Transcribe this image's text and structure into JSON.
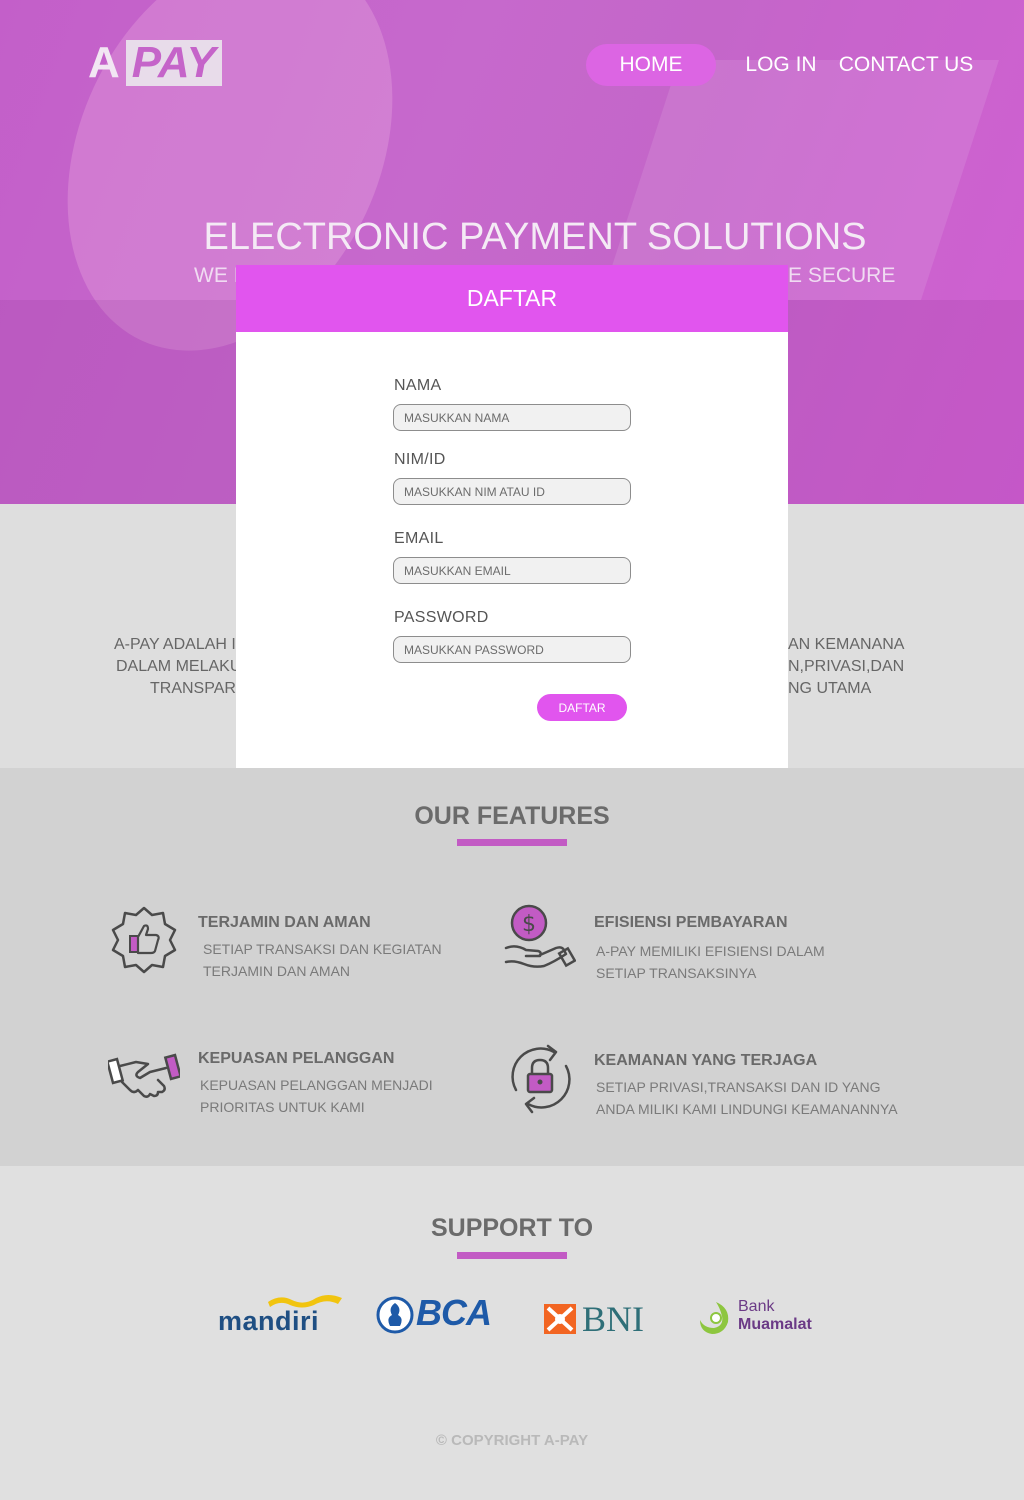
{
  "brand": {
    "logo_a": "A",
    "logo_pay": "PAY",
    "accent": "#c25bc4",
    "modal_accent": "#e155ee"
  },
  "nav": {
    "home": "HOME",
    "login": "LOG IN",
    "contact": "CONTACT US"
  },
  "hero": {
    "title": "ELECTRONIC PAYMENT SOLUTIONS",
    "subtitle_left": "WE I",
    "subtitle_right": "E SECURE"
  },
  "about": {
    "line1_left": "A-PAY ADALAH I",
    "line1_right": "AN KEMANANA",
    "line2_left": "DALAM MELAKU",
    "line2_right": "N,PRIVASI,DAN",
    "line3_left": "TRANSPARA",
    "line3_right": "NG UTAMA"
  },
  "features": {
    "title": "OUR FEATURES",
    "items": [
      {
        "icon": "thumbs-up-badge-icon",
        "title": "TERJAMIN DAN AMAN",
        "desc1": "SETIAP TRANSAKSI DAN KEGIATAN",
        "desc2": "TERJAMIN DAN AMAN"
      },
      {
        "icon": "hand-dollar-coin-icon",
        "title": "EFISIENSI PEMBAYARAN",
        "desc1": "A-PAY MEMILIKI EFISIENSI DALAM",
        "desc2": "SETIAP TRANSAKSINYA"
      },
      {
        "icon": "handshake-icon",
        "title": "KEPUASAN PELANGGAN",
        "desc1": "KEPUASAN PELANGGAN MENJADI",
        "desc2": "PRIORITAS UNTUK KAMI"
      },
      {
        "icon": "padlock-refresh-icon",
        "title": "KEAMANAN YANG TERJAGA",
        "desc1": "SETIAP PRIVASI,TRANSAKSI DAN ID YANG",
        "desc2": "ANDA MILIKI KAMI LINDUNGI KEAMANANNYA"
      }
    ]
  },
  "support": {
    "title": "SUPPORT TO",
    "banks": [
      {
        "name": "mandiri",
        "color": "#1f4f83"
      },
      {
        "name": "BCA",
        "color": "#1e5aa8"
      },
      {
        "name": "BNI",
        "color": "#2f6f78"
      },
      {
        "name": "Bank",
        "name2": "Muamalat",
        "color": "#6b3a86"
      }
    ]
  },
  "footer": {
    "copyright": "© COPYRIGHT A-PAY"
  },
  "modal": {
    "title": "DAFTAR",
    "fields": [
      {
        "label": "NAMA",
        "placeholder": "MASUKKAN NAMA"
      },
      {
        "label": "NIM/ID",
        "placeholder": "MASUKKAN NIM ATAU ID"
      },
      {
        "label": "EMAIL",
        "placeholder": "MASUKKAN EMAIL"
      },
      {
        "label": "PASSWORD",
        "placeholder": "MASUKKAN PASSWORD"
      }
    ],
    "submit": "DAFTAR"
  }
}
